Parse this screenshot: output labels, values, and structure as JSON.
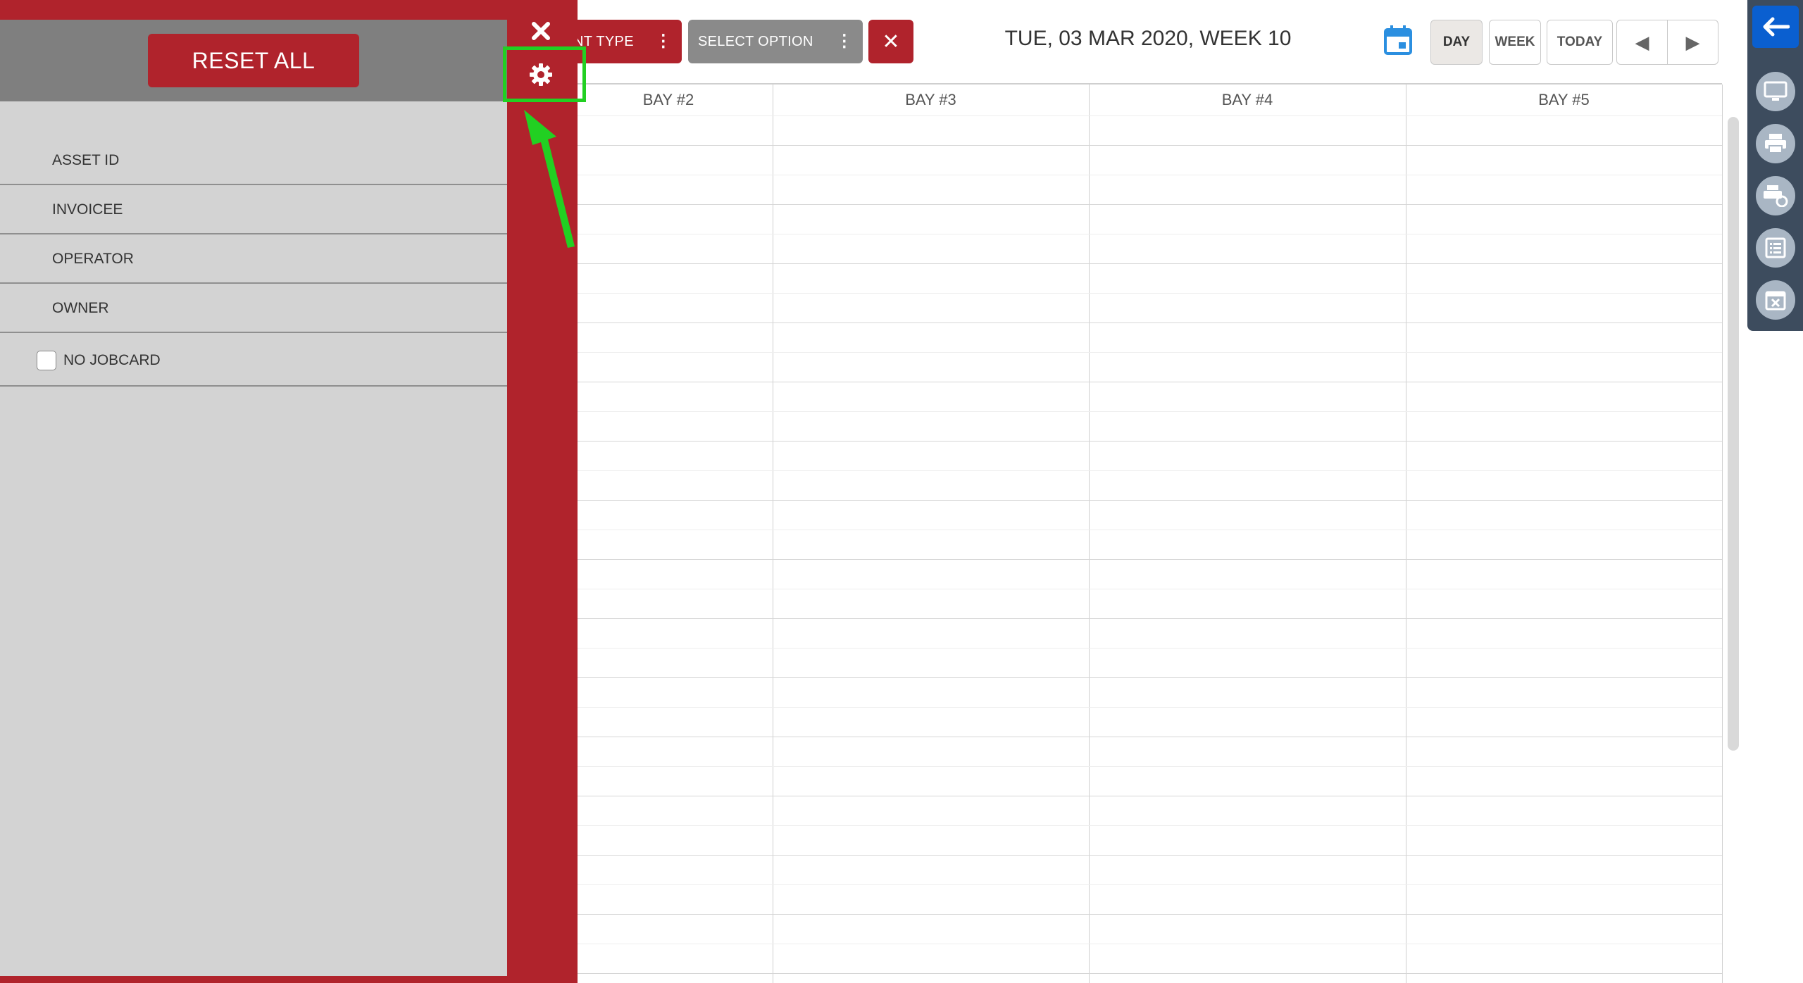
{
  "panel": {
    "reset_label": "RESET ALL",
    "fields": [
      "ASSET ID",
      "INVOICEE",
      "OPERATOR",
      "OWNER"
    ],
    "checkbox_label": "NO JOBCARD"
  },
  "toolbar": {
    "filter1_label": "NT TYPE",
    "filter2_label": "SELECT OPTION",
    "date_title": "TUE, 03 MAR 2020, WEEK 10",
    "views": [
      "DAY",
      "WEEK",
      "TODAY"
    ],
    "active_view": "DAY"
  },
  "grid": {
    "columns": [
      "BAY #2",
      "BAY #3",
      "BAY #4",
      "BAY #5"
    ]
  },
  "colors": {
    "brand_red": "#b0232c",
    "highlight_green": "#22d022",
    "back_blue": "#0a5fd0"
  },
  "icons": {
    "close": "close-icon",
    "gear": "gear-icon",
    "calendar": "calendar-icon",
    "right_toolbar": [
      "monitor-icon",
      "printer-icon",
      "print-settings-icon",
      "list-icon",
      "calendar-cancel-icon"
    ]
  }
}
